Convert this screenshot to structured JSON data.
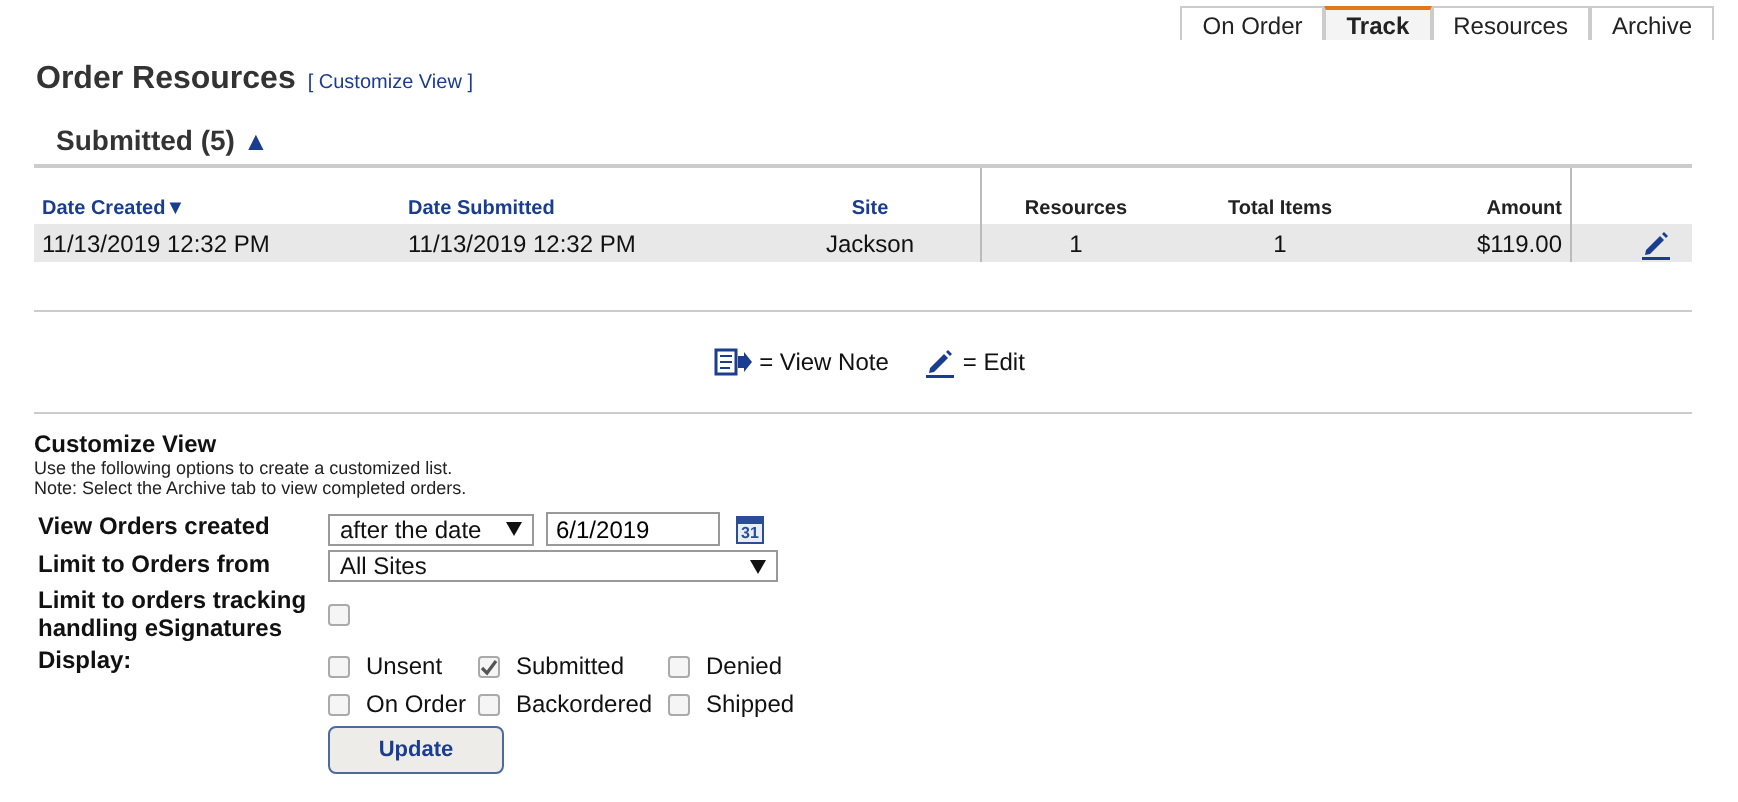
{
  "tabs": [
    {
      "label": "On Order",
      "selected": false
    },
    {
      "label": "Track",
      "selected": true
    },
    {
      "label": "Resources",
      "selected": false
    },
    {
      "label": "Archive",
      "selected": false
    }
  ],
  "title": "Order Resources",
  "customize_link": "[ Customize View ]",
  "section": {
    "title": "Submitted (5)",
    "toggle": "▲"
  },
  "table": {
    "columns": [
      {
        "label": "Date Created",
        "sort": "▼",
        "kind": "link"
      },
      {
        "label": "Date Submitted",
        "kind": "link"
      },
      {
        "label": "Site",
        "kind": "link"
      },
      {
        "label": "Resources",
        "kind": "plain"
      },
      {
        "label": "Total Items",
        "kind": "plain"
      },
      {
        "label": "Amount",
        "kind": "plain"
      }
    ],
    "rows": [
      {
        "cells": [
          "11/13/2019 12:32 PM",
          "11/13/2019 12:32 PM",
          "Jackson",
          "1",
          "1",
          "$119.00"
        ]
      }
    ]
  },
  "legend": [
    {
      "kind": "note",
      "label": "= View Note"
    },
    {
      "kind": "edit",
      "label": "= Edit"
    }
  ],
  "customize": {
    "title": "Customize View",
    "lines": [
      "Use the following options to create a customized list.",
      "Note: Select the Archive tab to view completed orders."
    ],
    "created_label": "View Orders created",
    "created_option": "after the date",
    "date": "6/1/2019",
    "calendar_day": "31",
    "site_label": "Limit to Orders from",
    "site_option": "All Sites",
    "esig_label": "Limit to orders tracking handling eSignatures",
    "esig_checked": false,
    "display_label": "Display:",
    "display": [
      {
        "label": "Unsent",
        "checked": false
      },
      {
        "label": "Submitted",
        "checked": true
      },
      {
        "label": "Denied",
        "checked": false
      },
      {
        "label": "On Order",
        "checked": false
      },
      {
        "label": "Backordered",
        "checked": false
      },
      {
        "label": "Shipped",
        "checked": false
      }
    ],
    "button": "Update"
  }
}
